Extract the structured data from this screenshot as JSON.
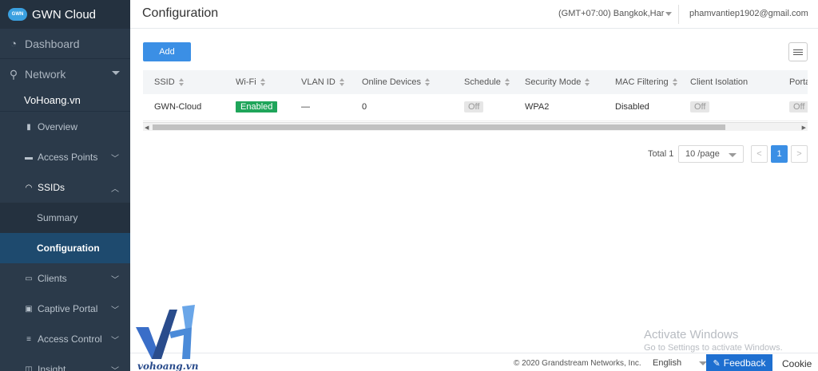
{
  "app": {
    "title": "GWN Cloud",
    "logo_text": "GWN"
  },
  "sidebar": {
    "dashboard": "Dashboard",
    "network": "Network",
    "site": "VoHoang.vn",
    "items": [
      {
        "label": "Overview"
      },
      {
        "label": "Access Points"
      },
      {
        "label": "SSIDs"
      },
      {
        "label": "Summary"
      },
      {
        "label": "Configuration"
      },
      {
        "label": "Clients"
      },
      {
        "label": "Captive Portal"
      },
      {
        "label": "Access Control"
      },
      {
        "label": "Insight"
      }
    ]
  },
  "header": {
    "title": "Configuration",
    "timezone": "(GMT+07:00) Bangkok,Har",
    "email": "phamvantiep1902@gmail.com"
  },
  "toolbar": {
    "add_label": "Add"
  },
  "table": {
    "columns": [
      "SSID",
      "Wi-Fi",
      "VLAN ID",
      "Online Devices",
      "Schedule",
      "Security Mode",
      "MAC Filtering",
      "Client Isolation",
      "Porta"
    ],
    "rows": [
      {
        "ssid": "GWN-Cloud",
        "wifi": "Enabled",
        "vlan": "—",
        "online": "0",
        "schedule": "Off",
        "security": "WPA2",
        "mac": "Disabled",
        "isolation": "Off",
        "portal": "Off"
      }
    ]
  },
  "pagination": {
    "total": "Total 1",
    "page_size": "10 /page",
    "prev": "<",
    "current": "1",
    "next": ">"
  },
  "footer": {
    "copyright": "© 2020 Grandstream Networks, Inc.",
    "language": "English",
    "feedback": "Feedback",
    "cookie": "Cookie"
  },
  "watermark": {
    "line1": "Activate Windows",
    "line2": "Go to Settings to activate Windows."
  },
  "overlay_logo": {
    "text": "vohoang.vn"
  },
  "colors": {
    "sidebar": "#2b3a4a",
    "active": "#1e4a6e",
    "primary": "#3b8fe5",
    "enabled": "#1fa55a"
  }
}
